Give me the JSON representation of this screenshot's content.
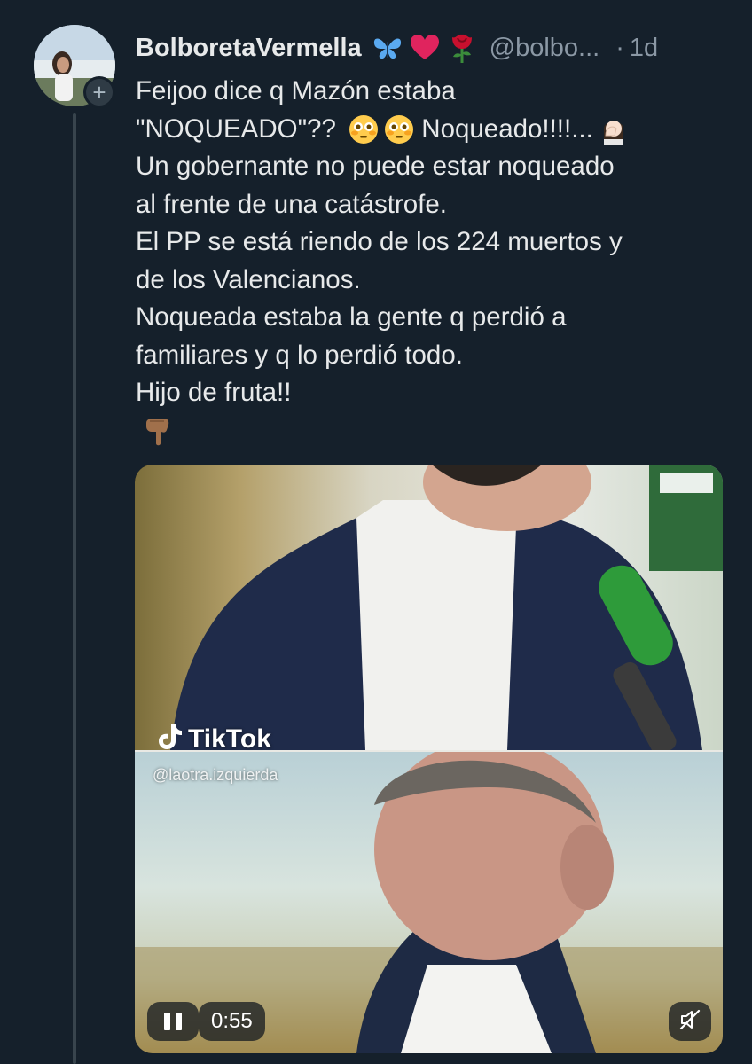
{
  "author": {
    "display_name": "BolboretaVermella",
    "name_emojis": [
      "butterfly-icon",
      "red-heart-icon",
      "rose-icon"
    ],
    "handle": "@bolbo...",
    "separator": "·",
    "time": "1d",
    "follow_badge": "+"
  },
  "tweet": {
    "lines": [
      "Feijoo dice q Mazón estaba",
      "\"NOQUEADO\"?? ",
      "Un gobernante no puede estar noqueado",
      "al frente de una catástrofe.",
      "El PP se está riendo de los 224 muertos y",
      "de los Valencianos.",
      "Noqueada estaba la gente q perdió a",
      "familiares y q lo perdió todo.",
      "Hijo de fruta!!"
    ],
    "line2_suffix": " Noqueado!!!!...",
    "emoji_icons": [
      "flushed-face-icon",
      "flushed-face-icon",
      "facepalm-woman-icon",
      "pointing-down-hand-icon"
    ]
  },
  "video": {
    "watermark_brand": "TikTok",
    "watermark_handle": "@laotra.izquierda",
    "duration": "0:55",
    "state": "playing",
    "muted": true
  },
  "colors": {
    "background": "#15202b",
    "text": "#e7e9ea",
    "secondary_text": "#8b98a5",
    "thread_line": "#38444d"
  }
}
